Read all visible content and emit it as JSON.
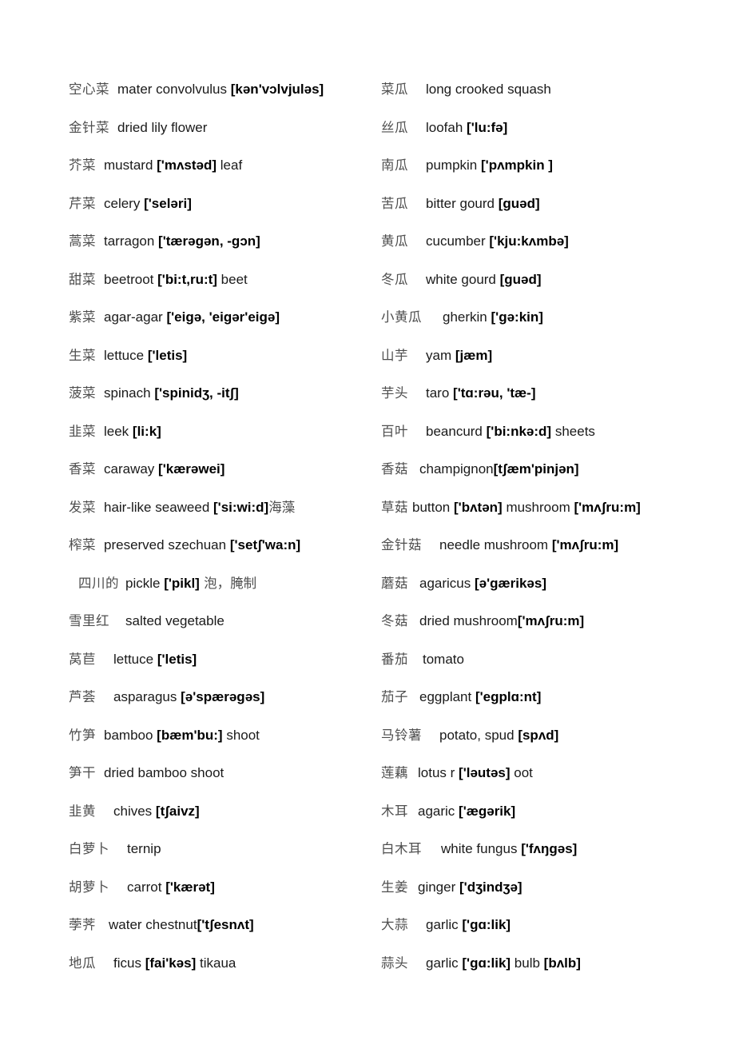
{
  "document": {
    "kind": "bilingual-vocabulary-glossary",
    "topic": "vegetables-and-fungi",
    "background_color": "#ffffff",
    "term_color": "#4e4e4e",
    "english_color": "#1a1a1a",
    "ipa_color": "#000000"
  },
  "left_column": [
    {
      "term": "空心菜",
      "english": "mater convolvulus ",
      "ipa": "[kən'vɔlvjuləs]",
      "english_tail": ""
    },
    {
      "term": "金针菜",
      "english": "dried lily flower",
      "ipa": "",
      "english_tail": ""
    },
    {
      "term": "芥菜",
      "english": "mustard ",
      "ipa": "['mʌstəd]",
      "english_tail": " leaf"
    },
    {
      "term": "芹菜",
      "english": "celery ",
      "ipa": "['seləri]",
      "english_tail": ""
    },
    {
      "term": "蒿菜",
      "english": "tarragon ",
      "ipa": "['tærəgən, -gɔn]",
      "english_tail": ""
    },
    {
      "term": "甜菜",
      "english": "beetroot ",
      "ipa": "['bi:t,ru:t]",
      "english_tail": " beet"
    },
    {
      "term": "紫菜",
      "english": "agar-agar ",
      "ipa": "['eigə, 'eigər'eigə]",
      "english_tail": ""
    },
    {
      "term": "生菜",
      "english": "lettuce ",
      "ipa": "['letis]",
      "english_tail": ""
    },
    {
      "term": "菠菜",
      "english": "spinach ",
      "ipa": "['spinidʒ, -itʃ]",
      "english_tail": ""
    },
    {
      "term": "韭菜",
      "english": "leek ",
      "ipa": "[li:k]",
      "english_tail": ""
    },
    {
      "term": "香菜",
      "english": "caraway ",
      "ipa": "['kærəwei]",
      "english_tail": ""
    },
    {
      "term": "发菜",
      "english": "hair-like seaweed ",
      "ipa": "['si:wi:d]",
      "english_tail": "海藻"
    },
    {
      "term": "榨菜",
      "english": "preserved szechuan ",
      "ipa": "['setʃ'wa:n]",
      "english_tail": ""
    },
    {
      "term": "四川的",
      "english": "pickle ",
      "ipa": "['pikl]",
      "english_tail": " 泡，腌制",
      "indented": true
    },
    {
      "term": "雪里红",
      "english": "salted vegetable",
      "ipa": "",
      "english_tail": ""
    },
    {
      "term": "莴苣",
      "english": "lettuce ",
      "ipa": "['letis]",
      "english_tail": ""
    },
    {
      "term": "芦荟",
      "english": "asparagus ",
      "ipa": "[ə'spærəgəs]",
      "english_tail": ""
    },
    {
      "term": "竹笋",
      "english": "bamboo ",
      "ipa": "[bæm'bu:]",
      "english_tail": " shoot"
    },
    {
      "term": "笋干",
      "english": "dried bamboo shoot",
      "ipa": "",
      "english_tail": ""
    },
    {
      "term": "韭黄",
      "english": "chives ",
      "ipa": "[tʃaivz]",
      "english_tail": ""
    },
    {
      "term": "白萝卜",
      "english": "ternip",
      "ipa": "",
      "english_tail": ""
    },
    {
      "term": "胡萝卜",
      "english": "carrot ",
      "ipa": "['kærət]",
      "english_tail": ""
    },
    {
      "term": "荸荠",
      "english": "water chestnut",
      "ipa": "['tʃesnʌt]",
      "english_tail": ""
    },
    {
      "term": "地瓜",
      "english": "ficus ",
      "ipa": "[fai'kəs]",
      "english_tail": " tikaua"
    }
  ],
  "right_column": [
    {
      "term": "菜瓜",
      "english": "long crooked squash",
      "ipa": "",
      "english_tail": ""
    },
    {
      "term": "丝瓜",
      "english": "loofah ",
      "ipa": "['lu:fə]",
      "english_tail": ""
    },
    {
      "term": "南瓜",
      "english": "pumpkin ",
      "ipa": "['pʌmpkin ]",
      "english_tail": ""
    },
    {
      "term": "苦瓜",
      "english": "bitter gourd ",
      "ipa": "[guəd]",
      "english_tail": ""
    },
    {
      "term": "黄瓜",
      "english": "cucumber ",
      "ipa": "['kju:kʌmbə]",
      "english_tail": ""
    },
    {
      "term": "冬瓜",
      "english": "white gourd ",
      "ipa": "[guəd]",
      "english_tail": ""
    },
    {
      "term": "小黄瓜",
      "english": "gherkin ",
      "ipa": "['gə:kin]",
      "english_tail": ""
    },
    {
      "term": "山芋",
      "english": "yam ",
      "ipa": "[jæm]",
      "english_tail": ""
    },
    {
      "term": "芋头",
      "english": "taro ",
      "ipa": "['tɑ:rəu, 'tæ-]",
      "english_tail": ""
    },
    {
      "term": "百叶",
      "english": "beancurd ",
      "ipa": "['bi:nkə:d]",
      "english_tail": " sheets"
    },
    {
      "term": "香菇",
      "english": "champignon",
      "ipa": "[tʃæm'pinjən]",
      "english_tail": ""
    },
    {
      "term": "草菇",
      "english": "button ",
      "ipa": "['bʌtən]",
      "english_tail": " mushroom ",
      "ipa2": "['mʌʃru:m]"
    },
    {
      "term": "金针菇",
      "english": "needle mushroom ",
      "ipa": "['mʌʃru:m]",
      "english_tail": ""
    },
    {
      "term": "蘑菇",
      "english": "agaricus ",
      "ipa": "[ə'gærikəs]",
      "english_tail": ""
    },
    {
      "term": "冬菇",
      "english": "dried mushroom",
      "ipa": "['mʌʃru:m]",
      "english_tail": ""
    },
    {
      "term": "番茄",
      "english": "tomato",
      "ipa": "",
      "english_tail": ""
    },
    {
      "term": "茄子",
      "english": "eggplant ",
      "ipa": "['egplɑ:nt]",
      "english_tail": ""
    },
    {
      "term": "马铃薯",
      "english": "potato, spud ",
      "ipa": "[spʌd]",
      "english_tail": ""
    },
    {
      "term": "莲藕",
      "english": "lotus r ",
      "ipa": "['ləutəs]",
      "english_tail": " oot"
    },
    {
      "term": "木耳",
      "english": "agaric ",
      "ipa": "['ægərik]",
      "english_tail": ""
    },
    {
      "term": "白木耳",
      "english": "white fungus ",
      "ipa": "['fʌŋgəs]",
      "english_tail": ""
    },
    {
      "term": "生姜",
      "english": "ginger ",
      "ipa": "['dʒindʒə]",
      "english_tail": ""
    },
    {
      "term": "大蒜",
      "english": "garlic ",
      "ipa": "['gɑ:lik]",
      "english_tail": ""
    },
    {
      "term": "蒜头",
      "english": "garlic ",
      "ipa": "['gɑ:lik]",
      "english_tail": " bulb ",
      "ipa2": "[bʌlb]"
    }
  ]
}
